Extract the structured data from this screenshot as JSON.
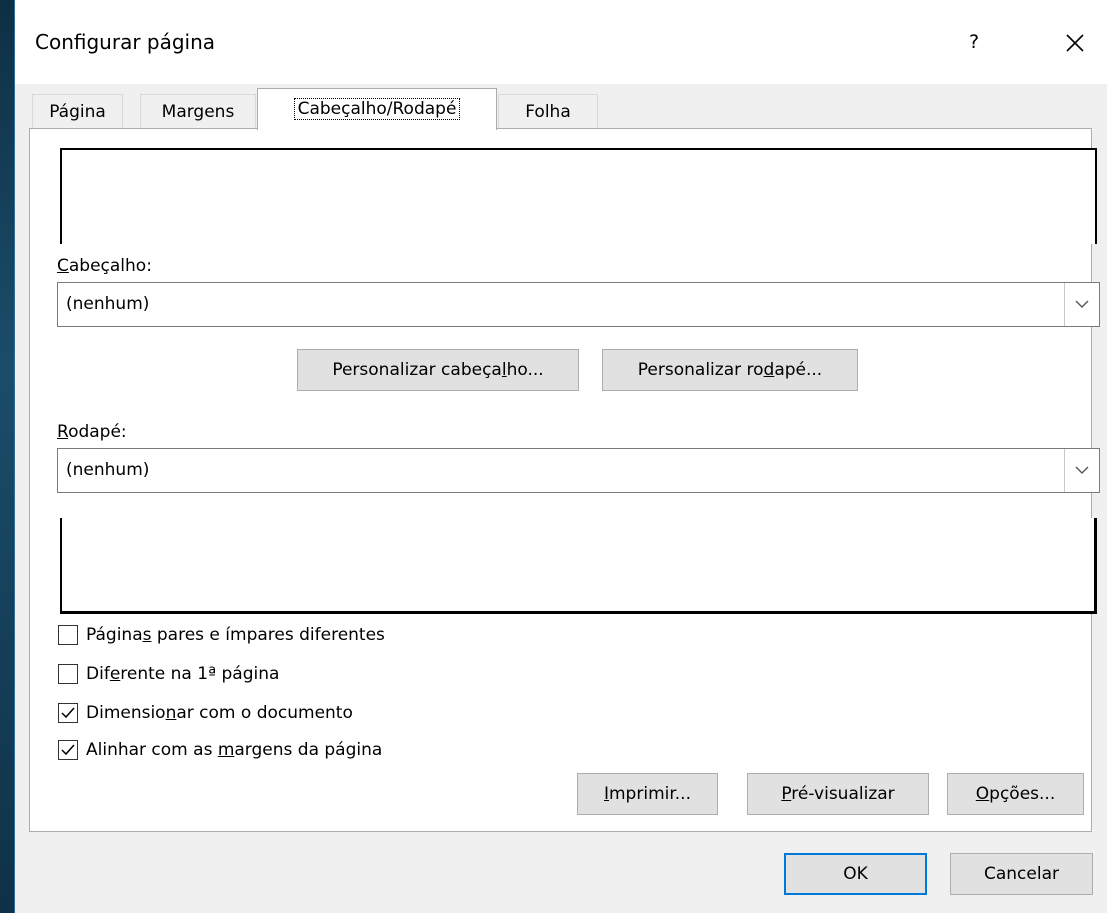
{
  "dialog": {
    "title": "Configurar página",
    "help_label": "?",
    "close_label": "✕"
  },
  "tabs": [
    {
      "label": "Página",
      "active": false
    },
    {
      "label": "Margens",
      "active": false
    },
    {
      "label": "Cabeçalho/Rodapé",
      "active": true
    },
    {
      "label": "Folha",
      "active": false
    }
  ],
  "header": {
    "label_first": "C",
    "label_rest": "abeçalho:",
    "value": "(nenhum)"
  },
  "custom_buttons": {
    "header_pre": "Personalizar cabeça",
    "header_u": "l",
    "header_post": "ho...",
    "footer_pre": "Personalizar ro",
    "footer_u": "d",
    "footer_post": "apé..."
  },
  "footer": {
    "label_first": "R",
    "label_rest": "odapé:",
    "value": "(nenhum)"
  },
  "checkboxes": [
    {
      "pre": "Página",
      "u": "s",
      "post": " pares e ímpares diferentes",
      "checked": false
    },
    {
      "pre": "Dif",
      "u": "e",
      "post": "rente na 1ª página",
      "checked": false
    },
    {
      "pre": "Dimensio",
      "u": "n",
      "post": "ar com o documento",
      "checked": true
    },
    {
      "pre": "Alinhar com as ",
      "u": "m",
      "post": "argens da página",
      "checked": true
    }
  ],
  "action_buttons": {
    "print_u": "I",
    "print_rest": "mprimir...",
    "preview_u": "P",
    "preview_rest": "ré-visualizar",
    "options_u": "O",
    "options_rest": "pções..."
  },
  "footer_buttons": {
    "ok": "OK",
    "cancel": "Cancelar"
  }
}
